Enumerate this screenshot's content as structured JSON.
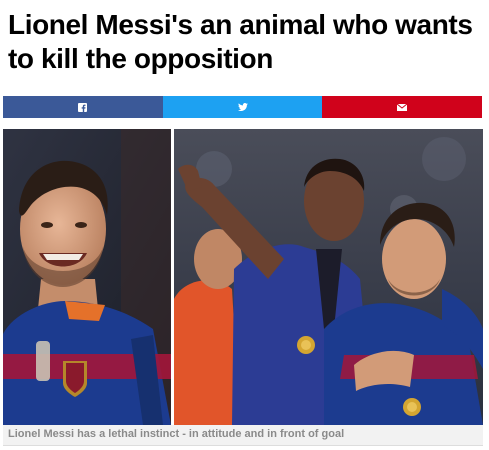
{
  "article": {
    "headline": "Lionel Messi's an animal who wants to kill the opposition",
    "caption": "Lionel Messi has a lethal instinct - in attitude and in front of goal"
  },
  "share_bar": {
    "buttons": [
      {
        "network": "facebook",
        "icon": "facebook-icon",
        "color": "#3b5998"
      },
      {
        "network": "twitter",
        "icon": "twitter-icon",
        "color": "#1da1f2"
      },
      {
        "network": "email",
        "icon": "email-icon",
        "color": "#d0021b"
      }
    ]
  },
  "colors": {
    "kit_blue": "#1c3b8f",
    "kit_red": "#a3163a",
    "stadium_bg": "#2a2f3d"
  }
}
